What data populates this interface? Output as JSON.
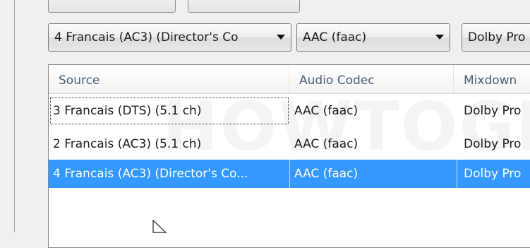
{
  "watermark": "HOWTOGEEK",
  "combos": {
    "source": "4 Francais (AC3) (Director's Co",
    "codec": "AAC (faac)",
    "mixdown": "Dolby Pro"
  },
  "table": {
    "columns": [
      "Source",
      "Audio Codec",
      "Mixdown"
    ],
    "rows": [
      {
        "source": "3 Francais (DTS) (5.1 ch)",
        "codec": "AAC (faac)",
        "mixdown": "Dolby Pro",
        "state": "focused"
      },
      {
        "source": "2 Francais (AC3) (5.1 ch)",
        "codec": "AAC (faac)",
        "mixdown": "Dolby Pro",
        "state": "normal"
      },
      {
        "source": "4 Francais (AC3) (Director's Co...",
        "codec": "AAC (faac)",
        "mixdown": "Dolby Pro",
        "state": "selected"
      }
    ]
  },
  "colors": {
    "selection": "#3399ff",
    "header_text": "#4c607a"
  }
}
